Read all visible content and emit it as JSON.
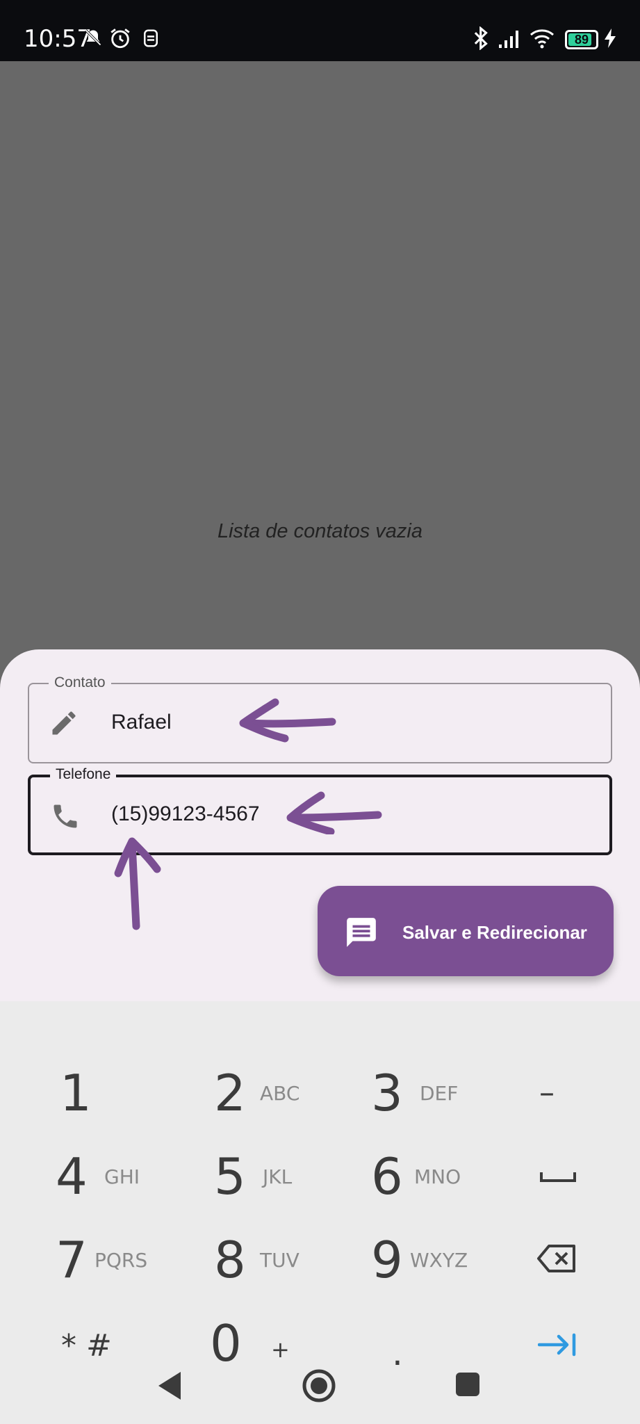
{
  "status_bar": {
    "time": "10:57",
    "battery_level": "89",
    "icons": [
      "mute-bell-icon",
      "alarm-icon",
      "app-icon",
      "bluetooth-icon",
      "signal-icon",
      "wifi-icon",
      "battery-icon",
      "charging-icon"
    ]
  },
  "main": {
    "empty_message": "Lista de contatos vazia"
  },
  "form": {
    "contact_label": "Contato",
    "contact_value": "Rafael",
    "phone_label": "Telefone",
    "phone_value": "(15)99123-4567"
  },
  "fab": {
    "label": "Salvar e Redirecionar",
    "icon": "message-icon",
    "color": "#7b4f93"
  },
  "keypad": {
    "rows": [
      [
        {
          "digit": "1",
          "letters": ""
        },
        {
          "digit": "2",
          "letters": "ABC"
        },
        {
          "digit": "3",
          "letters": "DEF"
        },
        {
          "digit": "–",
          "letters": ""
        }
      ],
      [
        {
          "digit": "4",
          "letters": "GHI"
        },
        {
          "digit": "5",
          "letters": "JKL"
        },
        {
          "digit": "6",
          "letters": "MNO"
        },
        {
          "digit": "space",
          "letters": ""
        }
      ],
      [
        {
          "digit": "7",
          "letters": "PQRS"
        },
        {
          "digit": "8",
          "letters": "TUV"
        },
        {
          "digit": "9",
          "letters": "WXYZ"
        },
        {
          "digit": "backspace",
          "letters": ""
        }
      ],
      [
        {
          "digit": "* #",
          "letters": ""
        },
        {
          "digit": "0",
          "letters": "+"
        },
        {
          "digit": ".",
          "letters": ""
        },
        {
          "digit": "next",
          "letters": ""
        }
      ]
    ],
    "key_1": "1",
    "key_2": "2",
    "key_2_letters": "ABC",
    "key_3": "3",
    "key_3_letters": "DEF",
    "key_dash": "–",
    "key_4": "4",
    "key_4_letters": "GHI",
    "key_5": "5",
    "key_5_letters": "JKL",
    "key_6": "6",
    "key_6_letters": "MNO",
    "key_7": "7",
    "key_7_letters": "PQRS",
    "key_8": "8",
    "key_8_letters": "TUV",
    "key_9": "9",
    "key_9_letters": "WXYZ",
    "key_star_hash": "* #",
    "key_0": "0",
    "key_0_letters": "+",
    "key_dot": "."
  },
  "accent_colors": {
    "annotation_arrow": "#7b4f93",
    "next_key": "#2f9ae0"
  }
}
